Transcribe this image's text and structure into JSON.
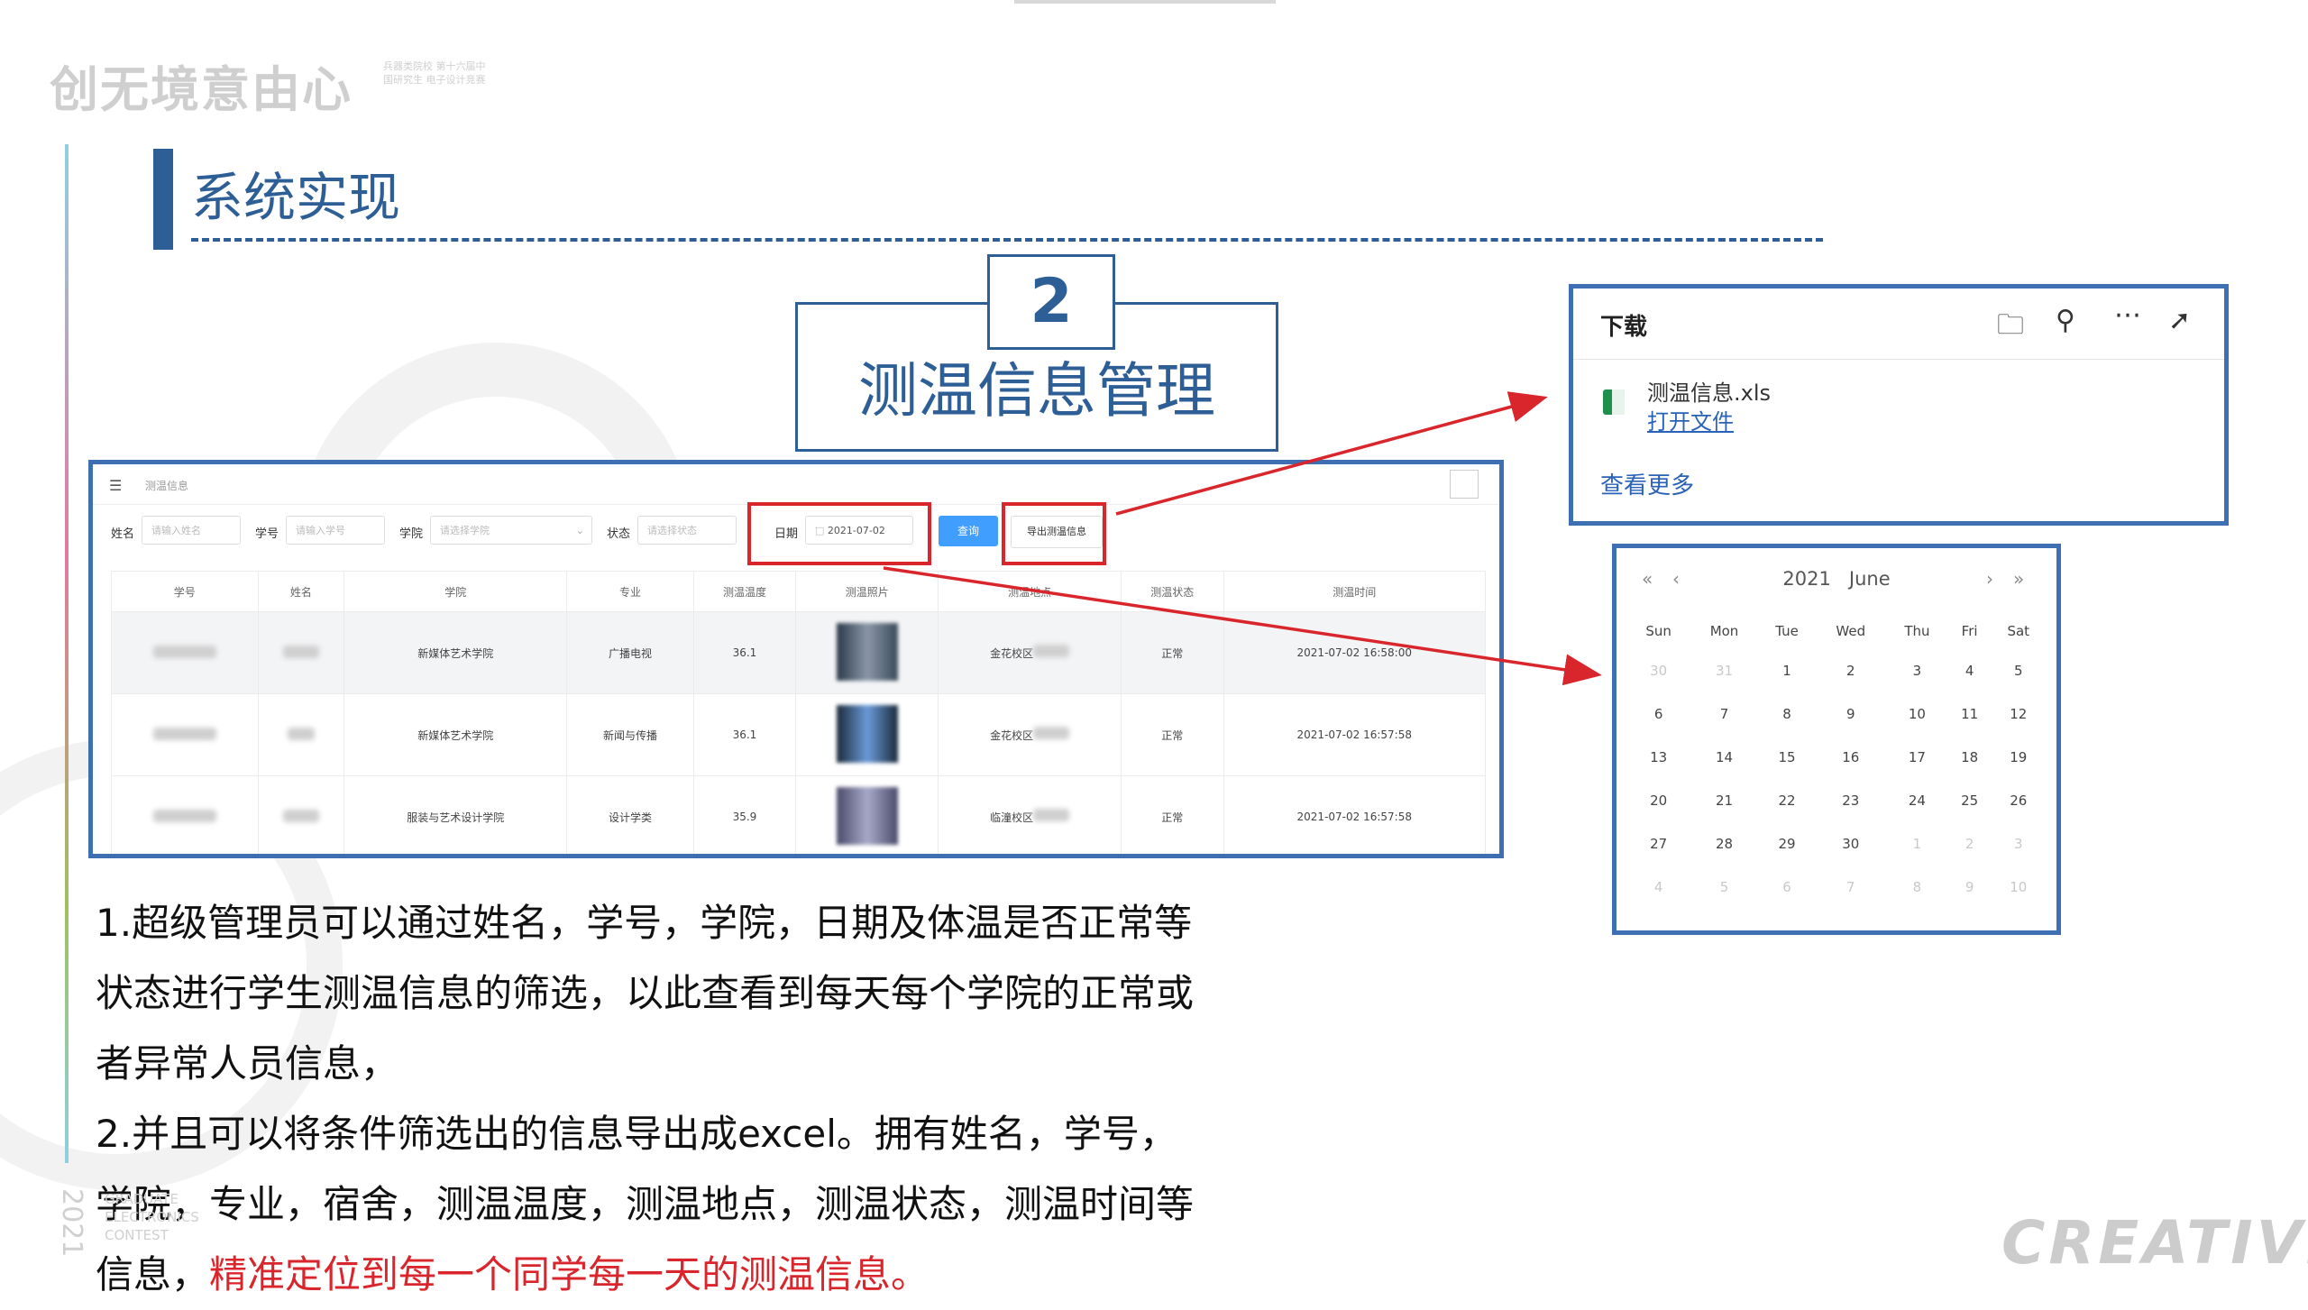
{
  "logo": {
    "text": "创无境意由心",
    "sub": "兵器类院校 第十六届中国研究生 电子设计竞赛"
  },
  "section": {
    "title": "系统实现"
  },
  "topic": {
    "number": "2",
    "title": "测温信息管理"
  },
  "app": {
    "breadcrumb": "测温信息",
    "filters": {
      "name_label": "姓名",
      "name_placeholder": "请输入姓名",
      "id_label": "学号",
      "id_placeholder": "请输入学号",
      "college_label": "学院",
      "college_placeholder": "请选择学院",
      "status_label": "状态",
      "status_placeholder": "请选择状态",
      "date_label": "日期",
      "date_value": "2021-07-02",
      "query_button": "查询",
      "export_button": "导出测温信息"
    },
    "table": {
      "headers": [
        "学号",
        "姓名",
        "学院",
        "专业",
        "测温温度",
        "测温照片",
        "测温地点",
        "测温状态",
        "测温时间"
      ],
      "rows": [
        {
          "college": "新媒体艺术学院",
          "major": "广播电视",
          "temp": "36.1",
          "location": "金花校区",
          "status": "正常",
          "time": "2021-07-02 16:58:00"
        },
        {
          "college": "新媒体艺术学院",
          "major": "新闻与传播",
          "temp": "36.1",
          "location": "金花校区",
          "status": "正常",
          "time": "2021-07-02 16:57:58"
        },
        {
          "college": "服装与艺术设计学院",
          "major": "设计学类",
          "temp": "35.9",
          "location": "临潼校区",
          "status": "正常",
          "time": "2021-07-02 16:57:58"
        }
      ]
    }
  },
  "download": {
    "title": "下载",
    "file": "测温信息.xls",
    "open": "打开文件",
    "more": "查看更多",
    "icons": [
      "folder-icon",
      "search-icon",
      "more-icon",
      "pin-icon"
    ]
  },
  "calendar": {
    "year": "2021",
    "month": "June",
    "weekdays": [
      "Sun",
      "Mon",
      "Tue",
      "Wed",
      "Thu",
      "Fri",
      "Sat"
    ],
    "weeks": [
      [
        "30",
        "31",
        "1",
        "2",
        "3",
        "4",
        "5"
      ],
      [
        "6",
        "7",
        "8",
        "9",
        "10",
        "11",
        "12"
      ],
      [
        "13",
        "14",
        "15",
        "16",
        "17",
        "18",
        "19"
      ],
      [
        "20",
        "21",
        "22",
        "23",
        "24",
        "25",
        "26"
      ],
      [
        "27",
        "28",
        "29",
        "30",
        "1",
        "2",
        "3"
      ],
      [
        "4",
        "5",
        "6",
        "7",
        "8",
        "9",
        "10"
      ]
    ]
  },
  "description": {
    "line1": "1.超级管理员可以通过姓名，学号，学院，日期及体温是否正常等",
    "line2": "状态进行学生测温信息的筛选，以此查看到每天每个学院的正常或",
    "line3": "者异常人员信息，",
    "line4": "2.并且可以将条件筛选出的信息导出成excel。拥有姓名，学号，",
    "line5": "学院，专业，宿舍，测温温度，测温地点，测温状态，测温时间等",
    "line6_plain": "信息，",
    "line6_red": "精准定位到每一个同学每一天的测温信息。"
  },
  "footer": {
    "creative": "CREATIVE",
    "year": "2021",
    "words": "GRADUATE ELECTRONICS CONTEST"
  },
  "colors": {
    "accent": "#2e5e96",
    "frame": "#3d6fb2",
    "highlight": "#d9262c",
    "link": "#2a62b8"
  }
}
